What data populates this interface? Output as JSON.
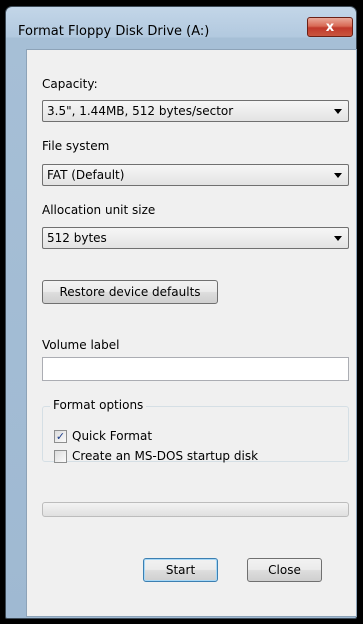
{
  "window": {
    "title": "Format Floppy Disk Drive (A:)",
    "close_glyph": "x"
  },
  "capacity": {
    "label": "Capacity:",
    "value": "3.5\",  1.44MB, 512 bytes/sector"
  },
  "file_system": {
    "label": "File system",
    "value": "FAT (Default)"
  },
  "allocation": {
    "label": "Allocation unit size",
    "value": "512 bytes"
  },
  "restore_button": "Restore device defaults",
  "volume": {
    "label": "Volume label",
    "value": ""
  },
  "format_options": {
    "legend": "Format options",
    "quick_format": {
      "label": "Quick Format",
      "checked": true
    },
    "msdos": {
      "label": "Create an MS-DOS startup disk",
      "checked": false
    }
  },
  "progress": {
    "value": 0
  },
  "buttons": {
    "start": "Start",
    "close": "Close"
  },
  "icons": {
    "check": "checkmark-icon",
    "dropdown": "chevron-down-icon",
    "close": "close-icon"
  },
  "colors": {
    "close_button": "#c8563f",
    "client_bg": "#f0f0f0",
    "frame": "#a6bfd6"
  }
}
